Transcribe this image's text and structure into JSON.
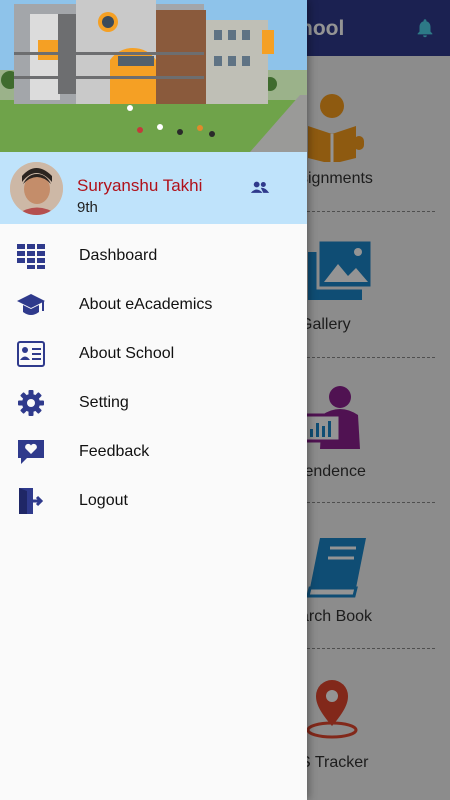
{
  "background_app": {
    "title": "hool",
    "tiles": [
      {
        "label": "signments",
        "icon": "reading-person-icon"
      },
      {
        "label": "Gallery",
        "icon": "gallery-icon"
      },
      {
        "label": "tendence",
        "icon": "presenter-icon"
      },
      {
        "label": "arch Book",
        "icon": "book-icon"
      },
      {
        "label": "S Tracker",
        "icon": "location-pin-icon"
      }
    ]
  },
  "drawer": {
    "user": {
      "name": "Suryanshu Takhi",
      "class": "9th"
    },
    "menu": [
      {
        "label": "Dashboard",
        "icon": "dashboard-icon"
      },
      {
        "label": "About eAcademics",
        "icon": "graduation-cap-icon"
      },
      {
        "label": "About School",
        "icon": "id-card-icon"
      },
      {
        "label": "Setting",
        "icon": "gear-icon"
      },
      {
        "label": "Feedback",
        "icon": "feedback-icon"
      },
      {
        "label": "Logout",
        "icon": "logout-icon"
      }
    ]
  },
  "colors": {
    "app_bar": "#2f3a8c",
    "drawer_icon": "#2f3a8c",
    "profile_bg": "#bfe3fb",
    "user_name": "#b0121b"
  }
}
